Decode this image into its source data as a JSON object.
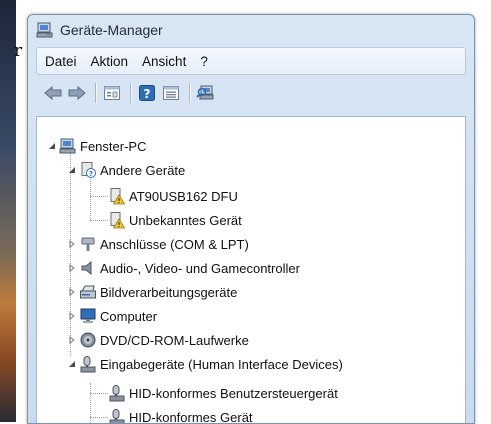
{
  "window": {
    "title": "Geräte-Manager"
  },
  "menu": {
    "items": [
      "Datei",
      "Aktion",
      "Ansicht",
      "?"
    ]
  },
  "toolbar": {
    "buttons": [
      "back-arrow-icon",
      "forward-arrow-icon",
      "properties-icon",
      "help-icon",
      "view-icon",
      "scan-hardware-icon"
    ]
  },
  "tree": {
    "root": "Fenster-PC",
    "other_devices": "Andere Geräte",
    "at90": "AT90USB162 DFU",
    "unknown": "Unbekanntes Gerät",
    "ports": "Anschlüsse (COM & LPT)",
    "audio": "Audio-, Video- und Gamecontroller",
    "imaging": "Bildverarbeitungsgeräte",
    "computer": "Computer",
    "dvd": "DVD/CD-ROM-Laufwerke",
    "hid": "Eingabegeräte (Human Interface Devices)",
    "hid_ctrl": "HID-konformes Benutzersteuergerät",
    "hid_dev": "HID-konformes Gerät"
  },
  "partial_text": {
    "edge_char": "r"
  },
  "colors": {
    "accent": "#2f6db5",
    "warning": "#f1c232"
  }
}
